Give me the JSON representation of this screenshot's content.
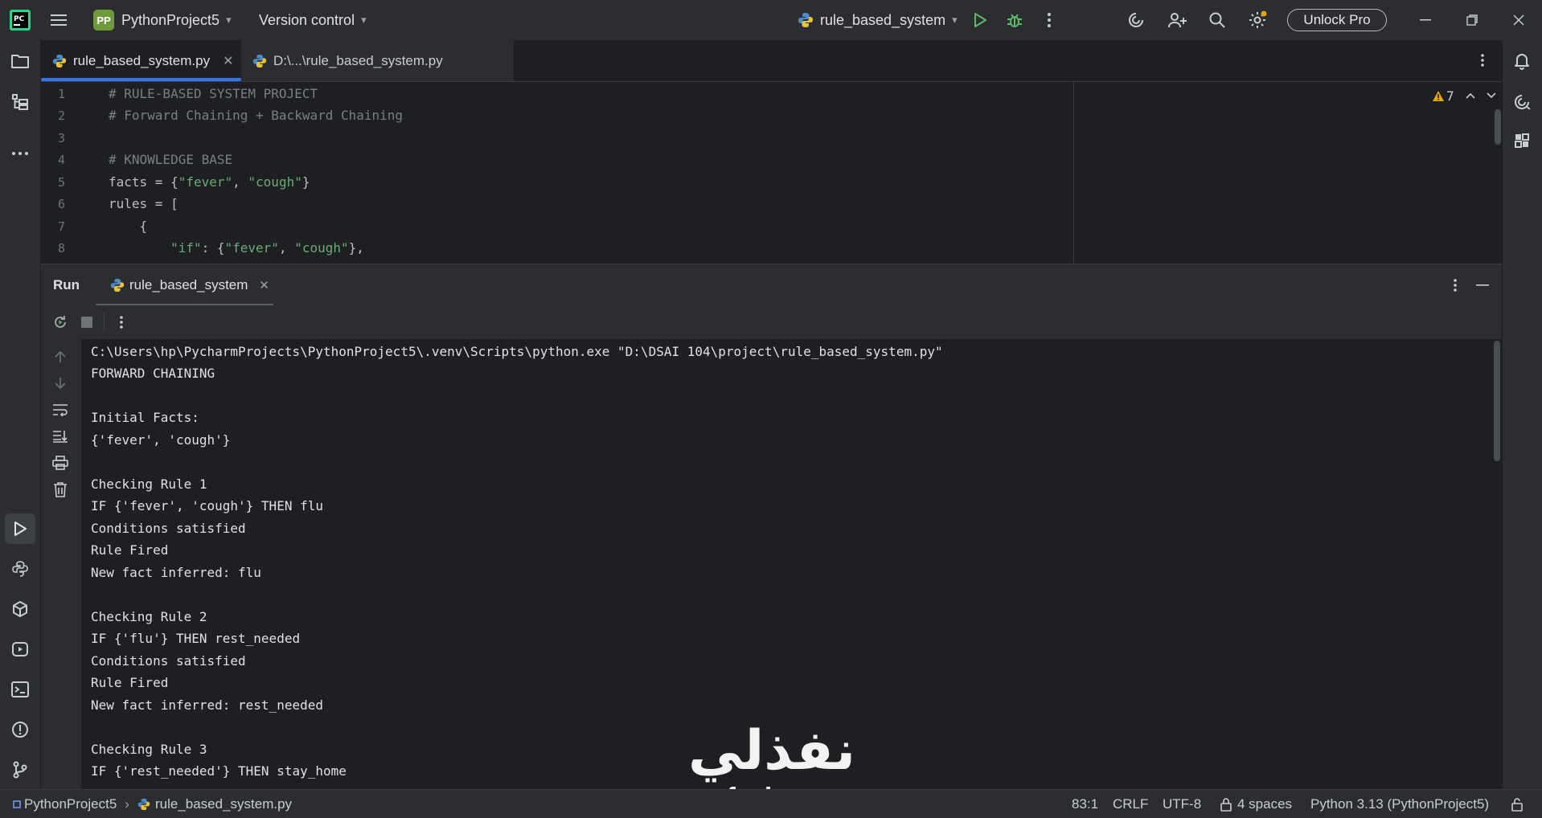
{
  "titlebar": {
    "project_badge": "PP",
    "project_name": "PythonProject5",
    "version_control": "Version control",
    "run_config": "rule_based_system",
    "unlock_pro": "Unlock Pro"
  },
  "editor": {
    "tabs": [
      {
        "label": "rule_based_system.py",
        "active": true
      },
      {
        "label": "D:\\...\\rule_based_system.py",
        "active": false
      }
    ],
    "warning_count": "7",
    "line_numbers": [
      "1",
      "2",
      "3",
      "4",
      "5",
      "6",
      "7",
      "8"
    ],
    "lines": {
      "l1": "# RULE-BASED SYSTEM PROJECT",
      "l2": "# Forward Chaining + Backward Chaining",
      "l4": "# KNOWLEDGE BASE",
      "l5_a": "facts = {",
      "l5_s1": "\"fever\"",
      "l5_b": ", ",
      "l5_s2": "\"cough\"",
      "l5_c": "}",
      "l6": "rules = [",
      "l7": "    {",
      "l8_a": "        ",
      "l8_s1": "\"if\"",
      "l8_b": ": {",
      "l8_s2": "\"fever\"",
      "l8_c": ", ",
      "l8_s3": "\"cough\"",
      "l8_d": "},"
    }
  },
  "run_panel": {
    "title": "Run",
    "tab_label": "rule_based_system",
    "output": [
      "C:\\Users\\hp\\PycharmProjects\\PythonProject5\\.venv\\Scripts\\python.exe \"D:\\DSAI 104\\project\\rule_based_system.py\"",
      "FORWARD CHAINING",
      "",
      "Initial Facts:",
      "{'fever', 'cough'}",
      "",
      "Checking Rule 1",
      "IF {'fever', 'cough'} THEN flu",
      "Conditions satisfied",
      "Rule Fired",
      "New fact inferred: flu",
      "",
      "Checking Rule 2",
      "IF {'flu'} THEN rest_needed",
      "Conditions satisfied",
      "Rule Fired",
      "New fact inferred: rest_needed",
      "",
      "Checking Rule 3",
      "IF {'rest_needed'} THEN stay_home"
    ]
  },
  "statusbar": {
    "project": "PythonProject5",
    "file": "rule_based_system.py",
    "position": "83:1",
    "line_separator": "CRLF",
    "encoding": "UTF-8",
    "indent": "4 spaces",
    "interpreter": "Python 3.13 (PythonProject5)"
  },
  "watermark": {
    "arabic": "نفذلي",
    "latin": "nafezly.com"
  },
  "colors": {
    "accent": "#3574f0",
    "run_green": "#5fb865",
    "string_green": "#6aab73",
    "comment_gray": "#7a7e85",
    "warning_orange": "#e5a50a"
  }
}
